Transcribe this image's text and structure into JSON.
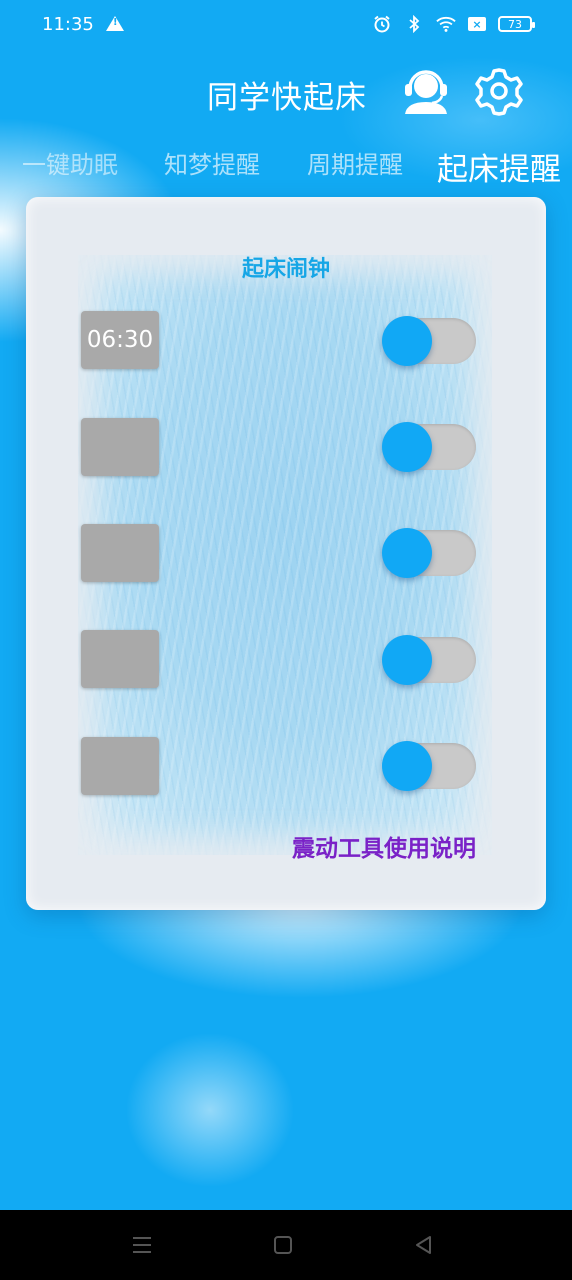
{
  "status_bar": {
    "time": "11:35",
    "battery": "73",
    "icons": [
      "warning-icon",
      "alarm-icon",
      "bluetooth-icon",
      "wifi-icon",
      "sim-x-icon",
      "battery-icon"
    ]
  },
  "header": {
    "title": "同学快起床",
    "icons": [
      "customer-service-icon",
      "gear-icon"
    ]
  },
  "tabs": [
    {
      "label": "一键助眠"
    },
    {
      "label": "知梦提醒"
    },
    {
      "label": "周期提醒"
    },
    {
      "label": "起床提醒",
      "active": true
    }
  ],
  "panel": {
    "title": "起床闹钟",
    "alarms": [
      {
        "time": "06:30",
        "enabled": true
      },
      {
        "time": "",
        "enabled": true
      },
      {
        "time": "",
        "enabled": true
      },
      {
        "time": "",
        "enabled": true
      },
      {
        "time": "",
        "enabled": true
      }
    ],
    "guide_link": "震动工具使用说明"
  },
  "colors": {
    "background": "#12aaf3",
    "accent": "#11a8f5",
    "title": "#16a6e6",
    "link": "#7a22c7",
    "slot": "#a9a9a9"
  },
  "nav": {
    "icons": [
      "menu-icon",
      "home-icon",
      "back-icon"
    ]
  }
}
